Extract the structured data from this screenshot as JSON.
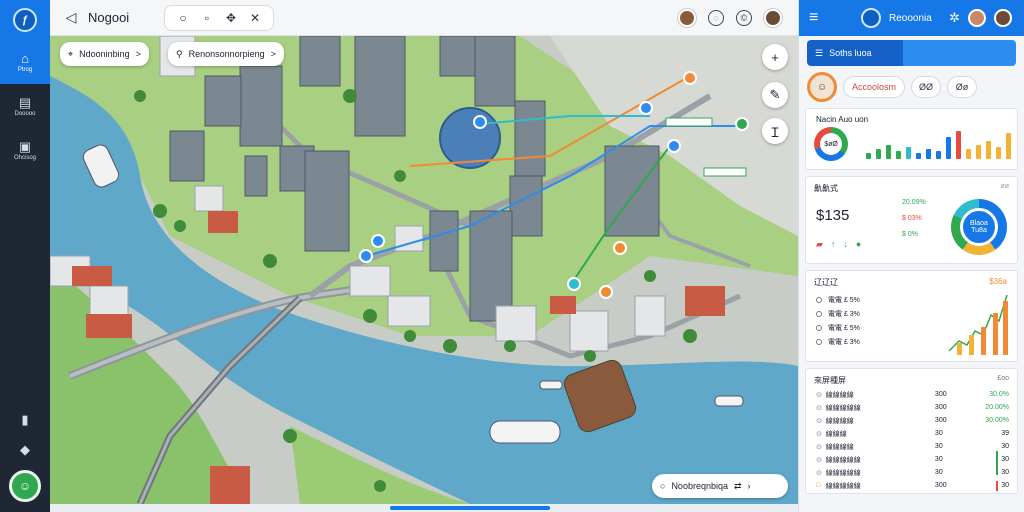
{
  "app": {
    "title": "Nogooi",
    "logo_letter": "ƒ"
  },
  "rail": {
    "items": [
      {
        "label": "Ptrog",
        "icon": "home-icon"
      },
      {
        "label": "Dooooo",
        "icon": "folder-icon"
      },
      {
        "label": "Ohcisog",
        "icon": "document-icon"
      }
    ],
    "bottom_items": [
      {
        "label": "",
        "icon": "bookmark-icon"
      },
      {
        "label": "",
        "icon": "megaphone-icon"
      }
    ]
  },
  "map": {
    "chips": [
      {
        "label": "Ndooninbing",
        "icon": "pin-icon",
        "arrow": ">"
      },
      {
        "label": "Renonsonnorpieng",
        "icon": "user-icon",
        "arrow": ">"
      }
    ],
    "route_search": {
      "label": "Noobreqnbiqa",
      "icon": "search-icon",
      "arrow": "⇄"
    }
  },
  "panel": {
    "brand": "Reooonia",
    "search_label": "Soths luoa",
    "chips": [
      "Accoolosm",
      "ØØ",
      "Øø"
    ],
    "card1": {
      "title": "Nacin Auo uon",
      "donut_label": "$øØ"
    },
    "card2": {
      "title": "鼽鼽式",
      "amount": "$135",
      "rows": [
        {
          "value": "20.09%",
          "color": "#2fa84f"
        },
        {
          "value": "$ 03%",
          "color": "#e84a3b"
        },
        {
          "value": "$ 0%",
          "color": "#2fa84f"
        }
      ],
      "ring_label": "Blaoa Tu8a",
      "corner": "øø"
    },
    "card3": {
      "title": "辽辽辽",
      "amount": "$36a",
      "rows": [
        "電電 £ 5%",
        "電電 £ 3%",
        "電電 £ 5%",
        "電電 £ 3%"
      ]
    },
    "card4": {
      "title": "來屏種屏",
      "corner": "£oo",
      "rows": [
        {
          "name": "線線線線",
          "a": "300",
          "b": "30.0%"
        },
        {
          "name": "線線線線線",
          "a": "300",
          "b": "20.00%"
        },
        {
          "name": "線線線線",
          "a": "300",
          "b": "30.00%"
        },
        {
          "name": "線線線",
          "a": "30",
          "b": "39"
        },
        {
          "name": "線線線線",
          "a": "30",
          "b": "30"
        },
        {
          "name": "線線線線線",
          "a": "30",
          "b": "30"
        },
        {
          "name": "線線線線線",
          "a": "30",
          "b": "30"
        },
        {
          "name": "線線線線線",
          "a": "300",
          "b": "30"
        }
      ]
    }
  },
  "colors": {
    "primary": "#1677e6",
    "rail": "#1f2735",
    "water": "#5fa8c9",
    "grass": "#9fc979",
    "route_blue": "#2d8cf0",
    "route_orange": "#f18a32",
    "route_green": "#2fa84f"
  }
}
